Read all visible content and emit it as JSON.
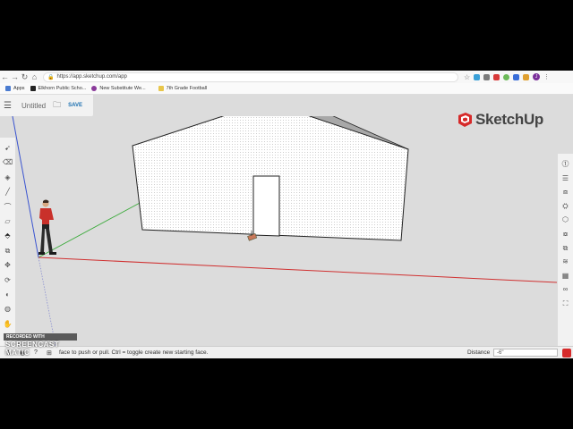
{
  "browser": {
    "url": "https://app.sketchup.com/app",
    "bookmarks": [
      {
        "label": "Apps",
        "color": "#4a7bd0"
      },
      {
        "label": "Elkhorn Public Scho...",
        "color": "#222222"
      },
      {
        "label": "New Substitute We...",
        "color": "#8a3a9a"
      },
      {
        "label": "7th Grade Football",
        "color": "#e8c64a"
      }
    ],
    "profile_initial": "J"
  },
  "app": {
    "menu_icon": "hamburger-icon",
    "title": "Untitled",
    "folder_icon": "folder-icon",
    "save_label": "SAVE",
    "logo_text": "SketchUp",
    "accent": "#d62a2a"
  },
  "statusbar": {
    "message": "face to push or pull. Ctrl = toggle create new starting face.",
    "distance_label": "Distance",
    "distance_value": "-6\""
  },
  "watermark": {
    "top": "RECORDED WITH",
    "bottom": "SCREENCAST  MATIC"
  }
}
